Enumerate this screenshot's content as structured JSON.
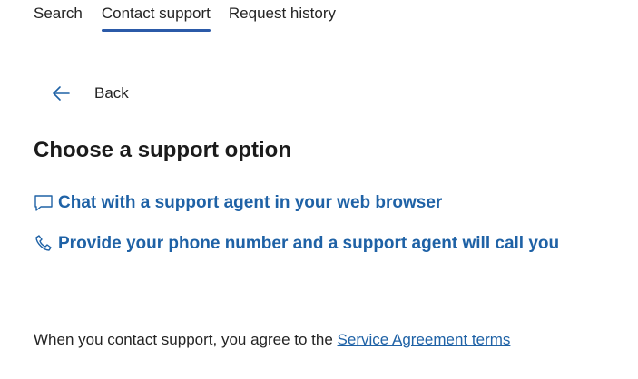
{
  "tabs": [
    {
      "label": "Search",
      "active": false
    },
    {
      "label": "Contact support",
      "active": true
    },
    {
      "label": "Request history",
      "active": false
    }
  ],
  "back": {
    "label": "Back",
    "icon": "arrow-left-icon"
  },
  "title": "Choose a support option",
  "options": [
    {
      "label": "Chat with a support agent in your web browser",
      "icon": "chat-bubble-icon"
    },
    {
      "label": "Provide your phone number and a support agent will call you",
      "icon": "phone-icon"
    }
  ],
  "footer": {
    "text": "When you contact support, you agree to the ",
    "link": "Service Agreement terms"
  },
  "colors": {
    "accent": "#1f62a6",
    "tab_underline": "#2b5aa8",
    "text": "#242424"
  }
}
